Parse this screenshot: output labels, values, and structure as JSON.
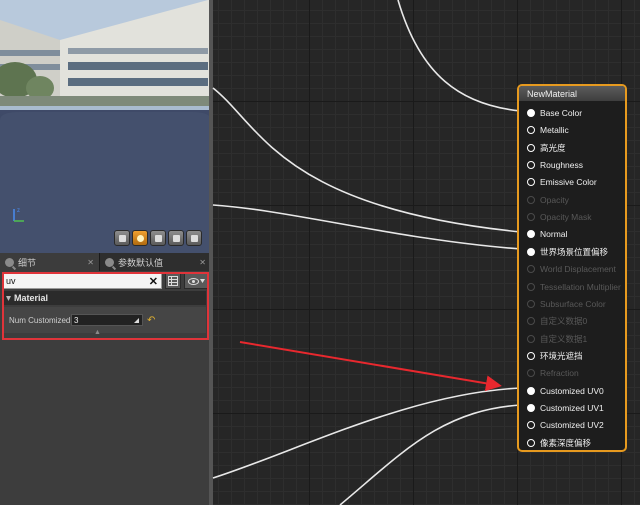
{
  "tabs": [
    {
      "label": "细节",
      "close": "✕"
    },
    {
      "label": "参数默认值",
      "close": "✕"
    }
  ],
  "search": {
    "value": "uv",
    "clear": "✕"
  },
  "category": {
    "title": "Material"
  },
  "property": {
    "label": "Num Customized",
    "value": "3"
  },
  "node": {
    "title": "NewMaterial",
    "pins": [
      {
        "label": "Base Color",
        "state": "on"
      },
      {
        "label": "Metallic",
        "state": "open"
      },
      {
        "label": "高光度",
        "state": "open"
      },
      {
        "label": "Roughness",
        "state": "open"
      },
      {
        "label": "Emissive Color",
        "state": "open"
      },
      {
        "label": "Opacity",
        "state": "off"
      },
      {
        "label": "Opacity Mask",
        "state": "off"
      },
      {
        "label": "Normal",
        "state": "on"
      },
      {
        "label": "世界场景位置偏移",
        "state": "on"
      },
      {
        "label": "World Displacement",
        "state": "off"
      },
      {
        "label": "Tessellation Multiplier",
        "state": "off"
      },
      {
        "label": "Subsurface Color",
        "state": "off"
      },
      {
        "label": "自定义数据0",
        "state": "off"
      },
      {
        "label": "自定义数据1",
        "state": "off"
      },
      {
        "label": "环境光遮挡",
        "state": "open"
      },
      {
        "label": "Refraction",
        "state": "off"
      },
      {
        "label": "Customized UV0",
        "state": "on"
      },
      {
        "label": "Customized UV1",
        "state": "on"
      },
      {
        "label": "Customized UV2",
        "state": "open"
      },
      {
        "label": "像素深度偏移",
        "state": "open"
      }
    ]
  },
  "colors": {
    "accent": "#e79a1f",
    "highlight": "#e0343a",
    "arrow": "#e8282e"
  }
}
